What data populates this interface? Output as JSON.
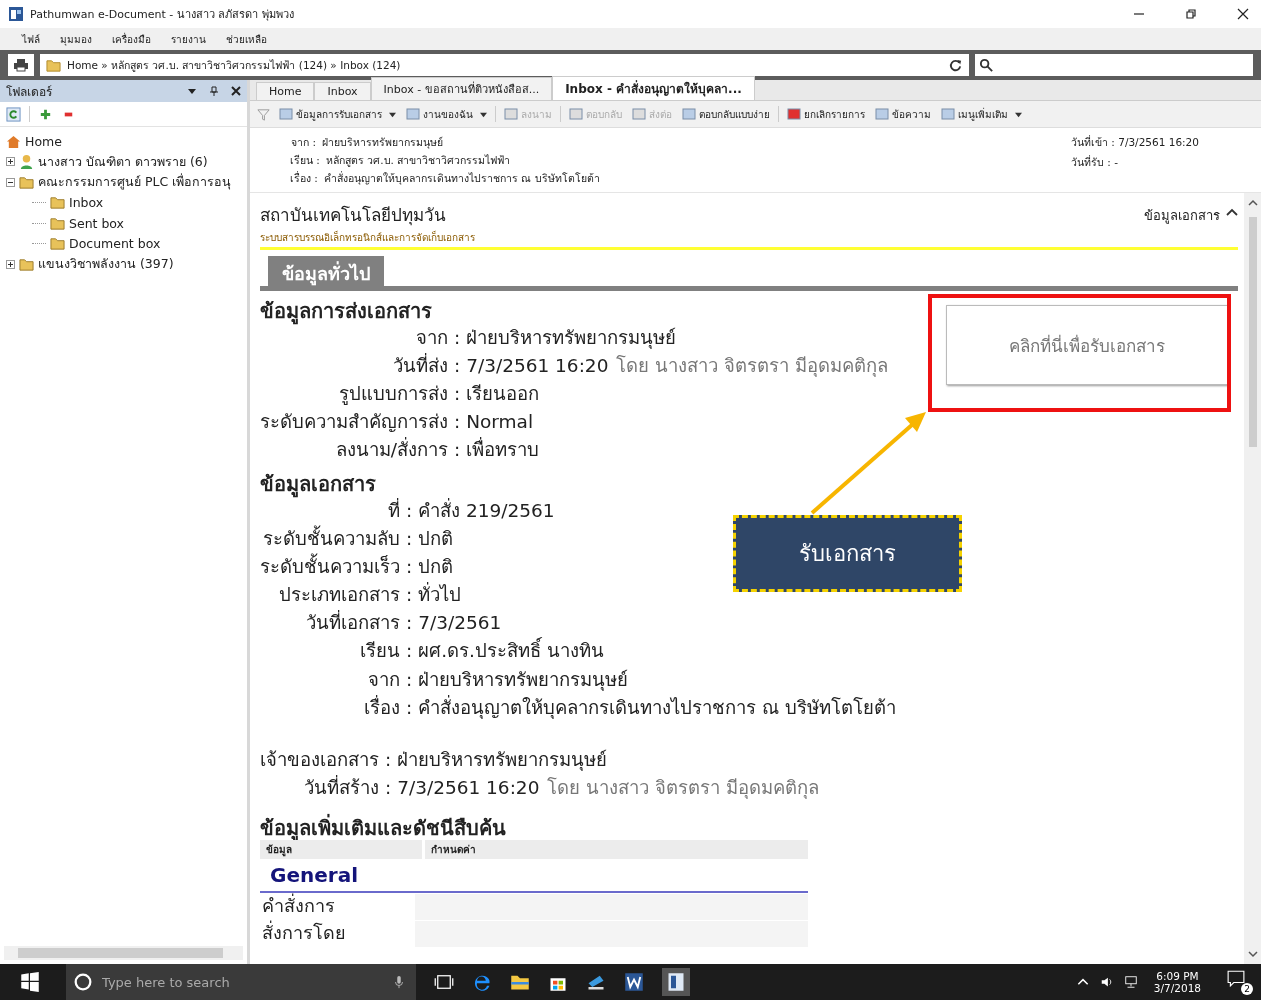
{
  "window": {
    "title": "Pathumwan e-Document - นางสาว ลภัสรดา พุ่มพวง"
  },
  "menu": [
    "ไฟล์",
    "มุมมอง",
    "เครื่องมือ",
    "รายงาน",
    "ช่วยเหลือ"
  ],
  "address": {
    "path": "Home » หลักสูตร วศ.บ. สาขาวิชาวิศวกรรมไฟฟ้า (124) » Inbox (124)"
  },
  "sidebar": {
    "title": "โฟลเดอร์",
    "items": [
      {
        "label": "Home",
        "children": [
          {
            "label": "นางสาว บัณฑิตา  ดาวพราย (6)",
            "expanded": false
          },
          {
            "label": "คณะกรรมการศูนย์ PLC เพื่อการอนุ",
            "expanded": true,
            "children": [
              {
                "label": "Inbox"
              },
              {
                "label": "Sent box"
              },
              {
                "label": "Document box"
              }
            ]
          },
          {
            "label": "แขนงวิชาพลังงาน (397)",
            "expanded": false
          }
        ]
      }
    ]
  },
  "tabs": [
    {
      "label": "Home",
      "selected": false
    },
    {
      "label": "Inbox",
      "selected": false
    },
    {
      "label": "Inbox - ขอสถานที่ติวหนังสือส...",
      "selected": false
    },
    {
      "label": "Inbox - คำสั่งอนุญาตให้บุคลา...",
      "selected": true
    }
  ],
  "toolbar": [
    {
      "label": "ข้อมูลการรับเอกสาร",
      "dropdown": true,
      "disabled": false
    },
    {
      "label": "งานของฉัน",
      "dropdown": true,
      "disabled": false
    },
    {
      "label": "ลงนาม",
      "dropdown": false,
      "disabled": true
    },
    {
      "label": "ตอบกลับ",
      "dropdown": false,
      "disabled": true
    },
    {
      "label": "ส่งต่อ",
      "dropdown": false,
      "disabled": true
    },
    {
      "label": "ตอบกลับแบบง่าย",
      "dropdown": false,
      "disabled": false
    },
    {
      "label": "ยกเลิกรายการ",
      "dropdown": false,
      "disabled": false
    },
    {
      "label": "ข้อความ",
      "dropdown": false,
      "disabled": false
    },
    {
      "label": "เมนูเพิ่มเติม",
      "dropdown": true,
      "disabled": false
    }
  ],
  "header": {
    "fields": [
      {
        "label": "จาก :",
        "value": "ฝ่ายบริหารทรัพยากรมนุษย์"
      },
      {
        "label": "เรียน :",
        "value": "หลักสูตร วศ.บ. สาขาวิชาวิศวกรรมไฟฟ้า"
      },
      {
        "label": "เรื่อง :",
        "value": "คำสั่งอนุญาตให้บุคลากรเดินทางไปราชการ ณ บริษัทโตโยต้า"
      }
    ],
    "dates": [
      "วันที่เข้า : 7/3/2561 16:20",
      "วันที่รับ : -"
    ]
  },
  "document": {
    "org": "สถาบันเทคโนโลยีปทุมวัน",
    "subtitle": "ระบบสารบรรณอิเล็กทรอนิกส์และการจัดเก็บเอกสาร",
    "link": "ข้อมูลเอกสาร",
    "section_tab": "ข้อมูลทั่วไป",
    "receive_button": "คลิกที่นี่เพื่อรับเอกสาร",
    "sections": [
      {
        "title": "ข้อมูลการส่งเอกสาร",
        "rows": [
          {
            "label": "จาก :",
            "value": "ฝ่ายบริหารทรัพยากรมนุษย์"
          },
          {
            "label": "วันที่ส่ง :",
            "value": "7/3/2561 16:20",
            "note": "โดย นางสาว จิตรตรา มีอุดมคติกุล"
          },
          {
            "label": "รูปแบบการส่ง :",
            "value": "เรียนออก"
          },
          {
            "label": "ระดับความสำคัญการส่ง :",
            "value": "Normal"
          },
          {
            "label": "ลงนาม/สั่งการ :",
            "value": "เพื่อทราบ"
          }
        ]
      },
      {
        "title": "ข้อมูลเอกสาร",
        "rows": [
          {
            "label": "ที่ :",
            "value": "คำสั่ง 219/2561"
          },
          {
            "label": "ระดับชั้นความลับ :",
            "value": "ปกติ"
          },
          {
            "label": "ระดับชั้นความเร็ว :",
            "value": "ปกติ"
          },
          {
            "label": "ประเภทเอกสาร :",
            "value": "ทั่วไป"
          },
          {
            "label": "วันที่เอกสาร :",
            "value": "7/3/2561"
          },
          {
            "label": "เรียน :",
            "value": "ผศ.ดร.ประสิทธิ์ นางทิน"
          },
          {
            "label": "จาก :",
            "value": "ฝ่ายบริหารทรัพยากรมนุษย์"
          },
          {
            "label": "เรื่อง :",
            "value": "คำสั่งอนุญาตให้บุคลากรเดินทางไปราชการ ณ บริษัทโตโยต้า"
          }
        ]
      },
      {
        "rows": [
          {
            "label": "เจ้าของเอกสาร :",
            "value": "ฝ่ายบริหารทรัพยากรมนุษย์"
          },
          {
            "label": "วันที่สร้าง :",
            "value": "7/3/2561 16:20",
            "note": "โดย นางสาว จิตรตรา มีอุดมคติกุล"
          }
        ]
      }
    ],
    "extra": {
      "title": "ข้อมูลเพิ่มเติมและดัชนีสืบค้น",
      "columns": [
        "ข้อมูล",
        "กำหนดค่า"
      ],
      "group": "General",
      "rows": [
        "คำสั่งการ",
        "สั่งการโดย"
      ]
    }
  },
  "annotation": {
    "callout": "รับเอกสาร"
  },
  "taskbar": {
    "search_placeholder": "Type here to search",
    "time": "6:09 PM",
    "date": "3/7/2018",
    "notifications": "2"
  }
}
